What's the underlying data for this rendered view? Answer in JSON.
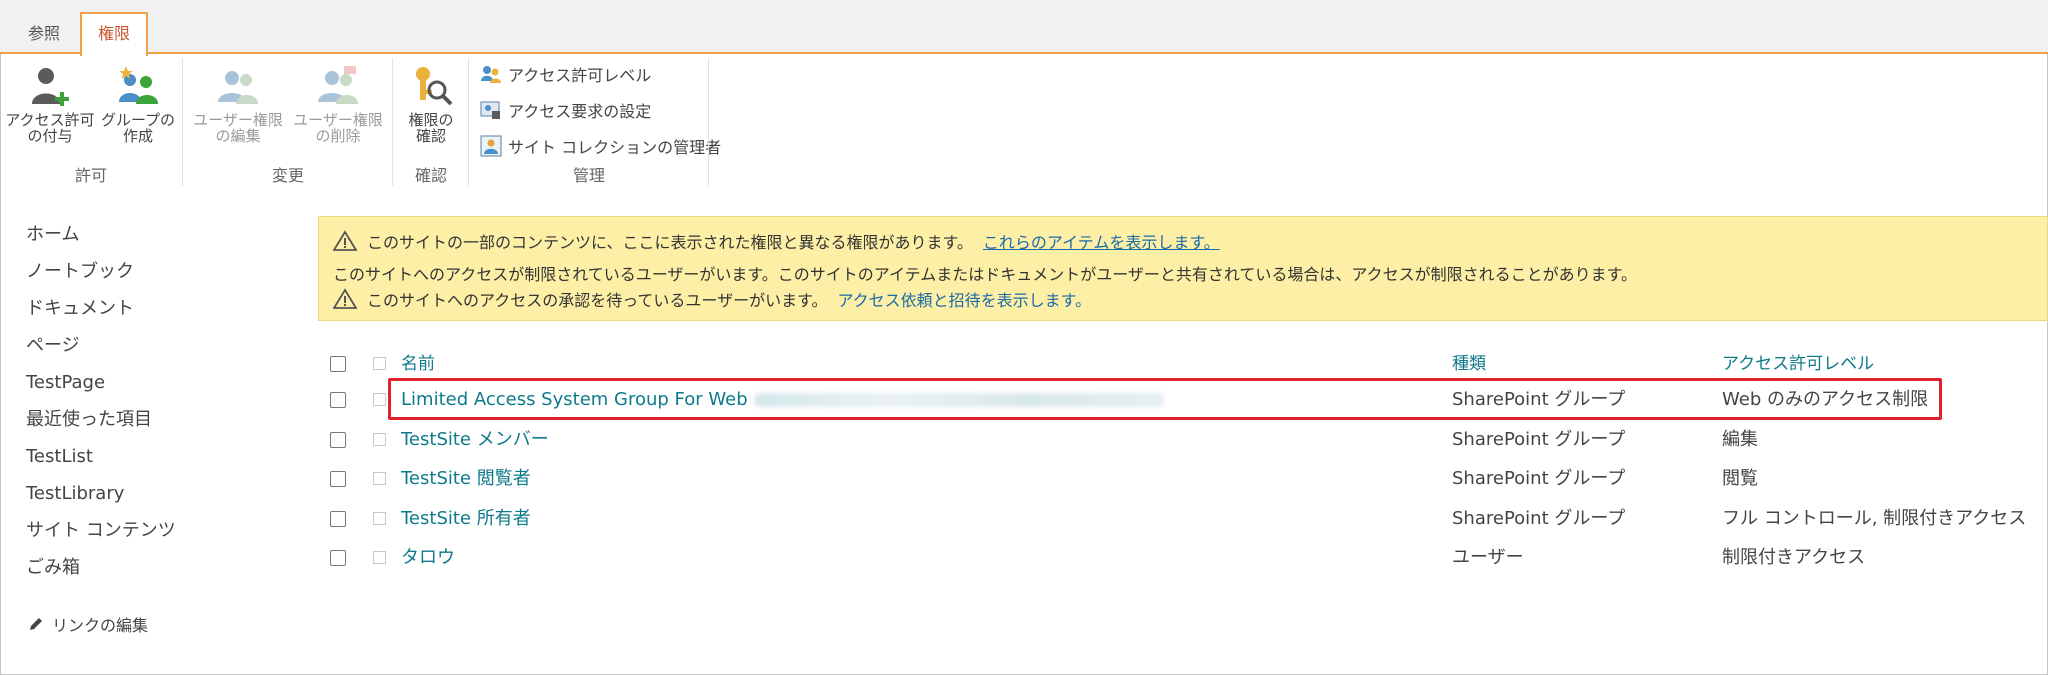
{
  "tabs": [
    {
      "label": "参照"
    },
    {
      "label": "権限"
    }
  ],
  "ribbon": {
    "grant_button": "アクセス許可\nの付与",
    "grant_line1": "アクセス許可",
    "grant_line2": "の付与",
    "create_group_line1": "グループの",
    "create_group_line2": "作成",
    "edit_user_perm_line1": "ユーザー権限",
    "edit_user_perm_line2": "の編集",
    "remove_user_perm_line1": "ユーザー権限",
    "remove_user_perm_line2": "の削除",
    "check_perm_line1": "権限の",
    "check_perm_line2": "確認",
    "groups": {
      "grant": "許可",
      "modify": "変更",
      "check": "確認",
      "manage": "管理"
    },
    "manage_items": {
      "permission_levels": "アクセス許可レベル",
      "access_request_settings": "アクセス要求の設定",
      "site_collection_admins": "サイト コレクションの管理者"
    }
  },
  "nav": {
    "items": [
      "ホーム",
      "ノートブック",
      "ドキュメント",
      "ページ",
      "TestPage",
      "最近使った項目",
      "TestList",
      "TestLibrary",
      "サイト コンテンツ",
      "ごみ箱"
    ],
    "edit_links": "リンクの編集"
  },
  "banner": {
    "line1_text": "このサイトの一部のコンテンツに、ここに表示された権限と異なる権限があります。",
    "line1_link": "これらのアイテムを表示します。",
    "line2_text": "このサイトへのアクセスが制限されているユーザーがいます。このサイトのアイテムまたはドキュメントがユーザーと共有されている場合は、アクセスが制限されることがあります。",
    "line3_text": "このサイトへのアクセスの承認を待っているユーザーがいます。",
    "line3_link": "アクセス依頼と招待を表示します。"
  },
  "table": {
    "headers": {
      "name": "名前",
      "type": "種類",
      "permission": "アクセス許可レベル"
    },
    "rows": [
      {
        "name": "Limited Access System Group For Web",
        "type": "SharePoint グループ",
        "permission": "Web のみのアクセス制限"
      },
      {
        "name": "TestSite メンバー",
        "type": "SharePoint グループ",
        "permission": "編集"
      },
      {
        "name": "TestSite 閲覧者",
        "type": "SharePoint グループ",
        "permission": "閲覧"
      },
      {
        "name": "TestSite 所有者",
        "type": "SharePoint グループ",
        "permission": "フル コントロール, 制限付きアクセス"
      },
      {
        "name": "タロウ",
        "type": "ユーザー",
        "permission": "制限付きアクセス"
      }
    ]
  },
  "colors": {
    "accent": "#f0a24a",
    "link": "#0e7a8c",
    "banner_bg": "#fdf0a6",
    "highlight": "#e0202a"
  }
}
